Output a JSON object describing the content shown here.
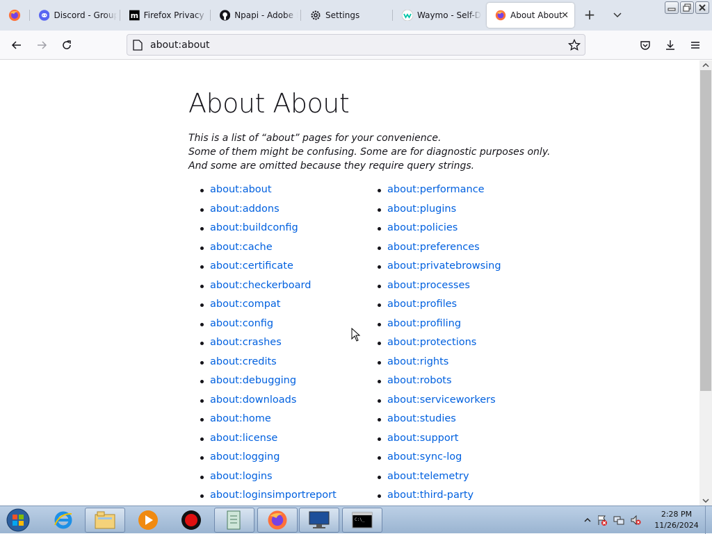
{
  "tabs": [
    {
      "title": "Discord - Group",
      "icon": "discord-icon"
    },
    {
      "title": "Firefox Privacy N",
      "icon": "mozilla-icon"
    },
    {
      "title": "Npapi - Adobe F",
      "icon": "github-icon"
    },
    {
      "title": "Settings",
      "icon": "gear-icon"
    },
    {
      "title": "Waymo - Self-D",
      "icon": "waymo-icon"
    },
    {
      "title": "About About",
      "icon": "firefox-icon",
      "active": true
    }
  ],
  "url": "about:about",
  "page": {
    "title": "About About",
    "intro": [
      "This is a list of “about” pages for your convenience.",
      "Some of them might be confusing. Some are for diagnostic purposes only.",
      "And some are omitted because they require query strings."
    ],
    "left_links": [
      "about:about",
      "about:addons",
      "about:buildconfig",
      "about:cache",
      "about:certificate",
      "about:checkerboard",
      "about:compat",
      "about:config",
      "about:crashes",
      "about:credits",
      "about:debugging",
      "about:downloads",
      "about:home",
      "about:license",
      "about:logging",
      "about:logins",
      "about:loginsimportreport"
    ],
    "right_links": [
      "about:performance",
      "about:plugins",
      "about:policies",
      "about:preferences",
      "about:privatebrowsing",
      "about:processes",
      "about:profiles",
      "about:profiling",
      "about:protections",
      "about:rights",
      "about:robots",
      "about:serviceworkers",
      "about:studies",
      "about:support",
      "about:sync-log",
      "about:telemetry",
      "about:third-party"
    ]
  },
  "taskbar": {
    "time": "2:28 PM",
    "date": "11/26/2024"
  },
  "colors": {
    "link": "#0060df",
    "tabstrip": "#dfe5ee",
    "navbar": "#f9f9fb"
  }
}
